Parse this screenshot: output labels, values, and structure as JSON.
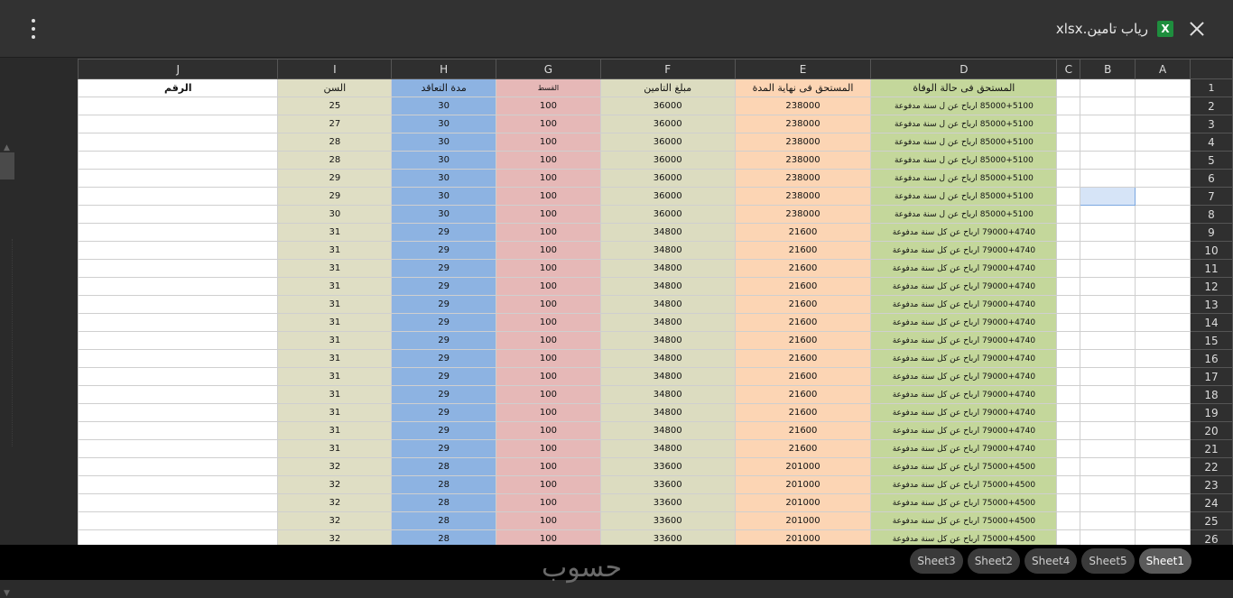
{
  "file": {
    "title": "رياب تامين.xlsx",
    "icon": "excel-icon",
    "icon_letter": "X"
  },
  "columns": [
    "J",
    "I",
    "H",
    "G",
    "F",
    "E",
    "D",
    "C",
    "B",
    "A"
  ],
  "header_row": {
    "J": "الرقم",
    "I": "السن",
    "H": "مدة التعاقد",
    "G": "القسط",
    "F": "مبلغ التامين",
    "E": "المستحق فى نهاية المدة",
    "D": "المستحق فى حالة الوفاة"
  },
  "rows": [
    {
      "n": "1"
    },
    {
      "n": "2",
      "I": "25",
      "H": "30",
      "G": "100",
      "F": "36000",
      "E": "238000",
      "D": "85000+5100 ارباح عن ل سنة مدفوعة"
    },
    {
      "n": "3",
      "I": "27",
      "H": "30",
      "G": "100",
      "F": "36000",
      "E": "238000",
      "D": "85000+5100 ارباح عن ل سنة مدفوعة"
    },
    {
      "n": "4",
      "I": "28",
      "H": "30",
      "G": "100",
      "F": "36000",
      "E": "238000",
      "D": "85000+5100 ارباح عن ل سنة مدفوعة"
    },
    {
      "n": "5",
      "I": "28",
      "H": "30",
      "G": "100",
      "F": "36000",
      "E": "238000",
      "D": "85000+5100 ارباح عن ل سنة مدفوعة"
    },
    {
      "n": "6",
      "I": "29",
      "H": "30",
      "G": "100",
      "F": "36000",
      "E": "238000",
      "D": "85000+5100 ارباح عن ل سنة مدفوعة"
    },
    {
      "n": "7",
      "I": "29",
      "H": "30",
      "G": "100",
      "F": "36000",
      "E": "238000",
      "D": "85000+5100 ارباح عن ل سنة مدفوعة"
    },
    {
      "n": "8",
      "I": "30",
      "H": "30",
      "G": "100",
      "F": "36000",
      "E": "238000",
      "D": "85000+5100 ارباح عن ل سنة مدفوعة"
    },
    {
      "n": "9",
      "I": "31",
      "H": "29",
      "G": "100",
      "F": "34800",
      "E": "21600",
      "D": "79000+4740 ارباح عن كل سنة مدفوعة"
    },
    {
      "n": "10",
      "I": "31",
      "H": "29",
      "G": "100",
      "F": "34800",
      "E": "21600",
      "D": "79000+4740 ارباح عن كل سنة مدفوعة"
    },
    {
      "n": "11",
      "I": "31",
      "H": "29",
      "G": "100",
      "F": "34800",
      "E": "21600",
      "D": "79000+4740 ارباح عن كل سنة مدفوعة"
    },
    {
      "n": "12",
      "I": "31",
      "H": "29",
      "G": "100",
      "F": "34800",
      "E": "21600",
      "D": "79000+4740 ارباح عن كل سنة مدفوعة"
    },
    {
      "n": "13",
      "I": "31",
      "H": "29",
      "G": "100",
      "F": "34800",
      "E": "21600",
      "D": "79000+4740 ارباح عن كل سنة مدفوعة"
    },
    {
      "n": "14",
      "I": "31",
      "H": "29",
      "G": "100",
      "F": "34800",
      "E": "21600",
      "D": "79000+4740 ارباح عن كل سنة مدفوعة"
    },
    {
      "n": "15",
      "I": "31",
      "H": "29",
      "G": "100",
      "F": "34800",
      "E": "21600",
      "D": "79000+4740 ارباح عن كل سنة مدفوعة"
    },
    {
      "n": "16",
      "I": "31",
      "H": "29",
      "G": "100",
      "F": "34800",
      "E": "21600",
      "D": "79000+4740 ارباح عن كل سنة مدفوعة"
    },
    {
      "n": "17",
      "I": "31",
      "H": "29",
      "G": "100",
      "F": "34800",
      "E": "21600",
      "D": "79000+4740 ارباح عن كل سنة مدفوعة"
    },
    {
      "n": "18",
      "I": "31",
      "H": "29",
      "G": "100",
      "F": "34800",
      "E": "21600",
      "D": "79000+4740 ارباح عن كل سنة مدفوعة"
    },
    {
      "n": "19",
      "I": "31",
      "H": "29",
      "G": "100",
      "F": "34800",
      "E": "21600",
      "D": "79000+4740 ارباح عن كل سنة مدفوعة"
    },
    {
      "n": "20",
      "I": "31",
      "H": "29",
      "G": "100",
      "F": "34800",
      "E": "21600",
      "D": "79000+4740 ارباح عن كل سنة مدفوعة"
    },
    {
      "n": "21",
      "I": "31",
      "H": "29",
      "G": "100",
      "F": "34800",
      "E": "21600",
      "D": "79000+4740 ارباح عن كل سنة مدفوعة"
    },
    {
      "n": "22",
      "I": "32",
      "H": "28",
      "G": "100",
      "F": "33600",
      "E": "201000",
      "D": "75000+4500 ارباح عن كل سنة مدفوعة"
    },
    {
      "n": "23",
      "I": "32",
      "H": "28",
      "G": "100",
      "F": "33600",
      "E": "201000",
      "D": "75000+4500 ارباح عن كل سنة مدفوعة"
    },
    {
      "n": "24",
      "I": "32",
      "H": "28",
      "G": "100",
      "F": "33600",
      "E": "201000",
      "D": "75000+4500 ارباح عن كل سنة مدفوعة"
    },
    {
      "n": "25",
      "I": "32",
      "H": "28",
      "G": "100",
      "F": "33600",
      "E": "201000",
      "D": "75000+4500 ارباح عن كل سنة مدفوعة"
    },
    {
      "n": "26",
      "I": "32",
      "H": "28",
      "G": "100",
      "F": "33600",
      "E": "201000",
      "D": "75000+4500 ارباح عن كل سنة مدفوعة"
    }
  ],
  "selected_cell": "B7",
  "sheets": [
    "Sheet3",
    "Sheet2",
    "Sheet4",
    "Sheet5",
    "Sheet1"
  ],
  "active_sheet": "Sheet1",
  "watermark": "حسوب"
}
